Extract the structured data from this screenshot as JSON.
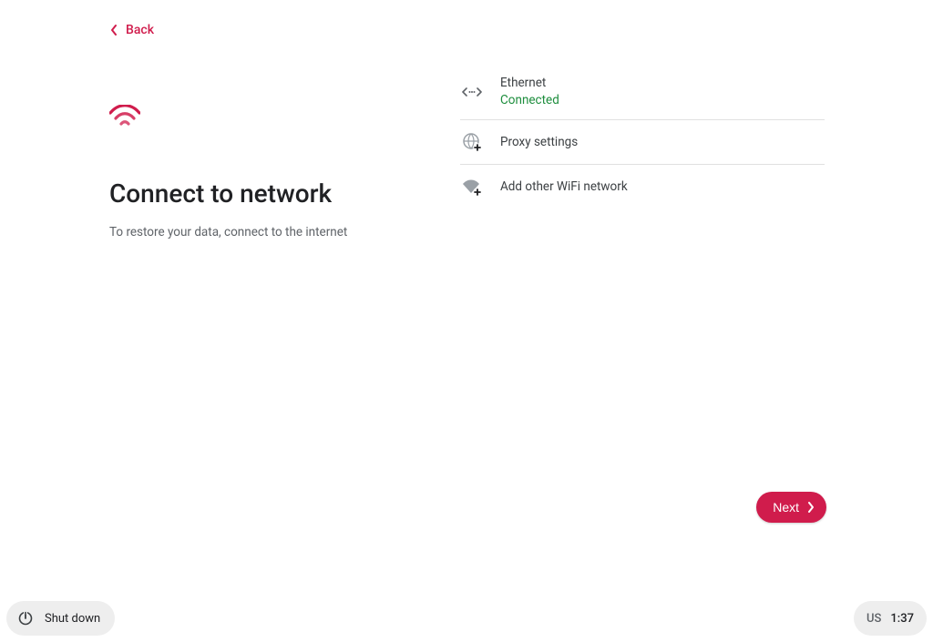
{
  "header": {
    "back_label": "Back"
  },
  "hero": {
    "title": "Connect to network",
    "subtitle": "To restore your data, connect to the internet"
  },
  "networks": {
    "ethernet_label": "Ethernet",
    "ethernet_status": "Connected",
    "proxy_label": "Proxy settings",
    "addwifi_label": "Add other WiFi network"
  },
  "footer": {
    "next_label": "Next"
  },
  "shelf": {
    "shutdown_label": "Shut down",
    "keyboard_label": "US",
    "clock": "1:37"
  },
  "colors": {
    "accent": "#d01c4c",
    "status_connected": "#1e8e3e"
  }
}
